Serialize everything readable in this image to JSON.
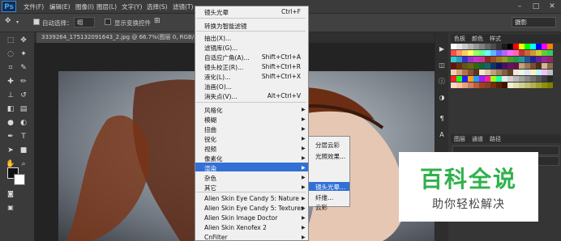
{
  "menubar": {
    "logo": "Ps",
    "items": [
      "文件(F)",
      "编辑(E)",
      "图像(I)",
      "图层(L)",
      "文字(Y)",
      "选择(S)",
      "滤镜(T)"
    ],
    "window_buttons": [
      "–",
      "□",
      "✕"
    ]
  },
  "options_bar": {
    "auto_select_label": "自动选择：",
    "auto_select_value": "组",
    "show_transform_label": "显示变换控件",
    "workspace": "摄影"
  },
  "document": {
    "tab_title": "3339264_175132091643_2.jpg @ 66.7%(图层 0, RGB/8#) *"
  },
  "panels": {
    "swatch_tabs": [
      "色板",
      "颜色",
      "样式"
    ],
    "layer_tabs": [
      "图层",
      "通道",
      "路径"
    ]
  },
  "filter_menu": {
    "items": [
      {
        "label": "镜头光晕",
        "shortcut": "Ctrl+F"
      },
      {
        "label": "转换为智能滤镜",
        "shortcut": ""
      },
      {
        "label": "抽出(X)...",
        "shortcut": ""
      },
      {
        "label": "滤镜库(G)...",
        "shortcut": ""
      },
      {
        "label": "自适应广角(A)...",
        "shortcut": "Shift+Ctrl+A"
      },
      {
        "label": "镜头校正(R)...",
        "shortcut": "Shift+Ctrl+R"
      },
      {
        "label": "液化(L)...",
        "shortcut": "Shift+Ctrl+X"
      },
      {
        "label": "油画(O)...",
        "shortcut": ""
      },
      {
        "label": "消失点(V)...",
        "shortcut": "Alt+Ctrl+V"
      },
      {
        "label": "风格化",
        "shortcut": ""
      },
      {
        "label": "模糊",
        "shortcut": ""
      },
      {
        "label": "扭曲",
        "shortcut": ""
      },
      {
        "label": "锐化",
        "shortcut": ""
      },
      {
        "label": "视频",
        "shortcut": ""
      },
      {
        "label": "像素化",
        "shortcut": ""
      },
      {
        "label": "渲染",
        "shortcut": ""
      },
      {
        "label": "杂色",
        "shortcut": ""
      },
      {
        "label": "其它",
        "shortcut": ""
      },
      {
        "label": "Alien Skin Eye Candy 5: Nature",
        "shortcut": ""
      },
      {
        "label": "Alien Skin Eye Candy 5: Textures",
        "shortcut": ""
      },
      {
        "label": "Alien Skin Image Doctor",
        "shortcut": ""
      },
      {
        "label": "Alien Skin Xenofex 2",
        "shortcut": ""
      },
      {
        "label": "CnFilter",
        "shortcut": ""
      }
    ],
    "highlighted": "渲染"
  },
  "render_submenu": {
    "items": [
      "分层云彩",
      "光照效果...",
      "镜头光晕...",
      "纤维...",
      "云彩"
    ],
    "highlighted": "镜头光晕..."
  },
  "watermark": {
    "title": "百科全说",
    "subtitle": "助你轻松解决"
  },
  "colors": {
    "highlight": "#3370d6",
    "watermark_green": "#2fb14b"
  }
}
